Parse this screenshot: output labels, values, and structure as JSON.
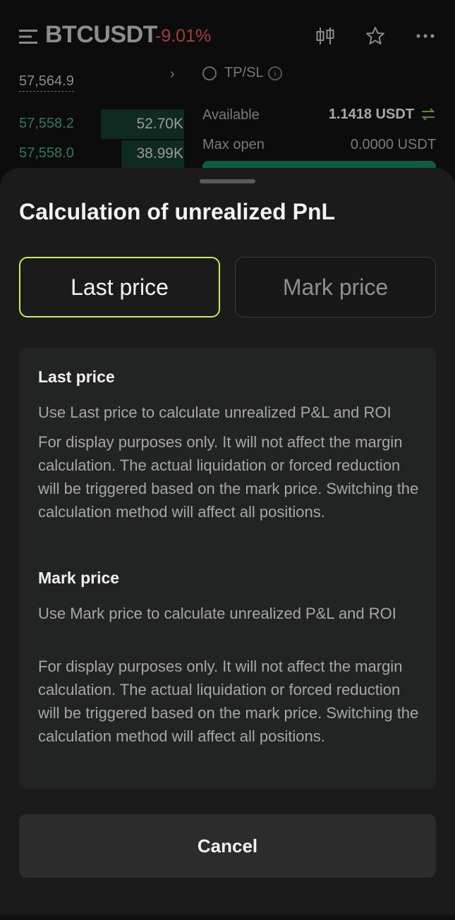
{
  "header": {
    "symbol": "BTCUSDT",
    "change": "-9.01%",
    "icons": [
      "menu-icon",
      "candlestick-icon",
      "star-icon",
      "more-icon"
    ]
  },
  "orderbook": {
    "reference_price": "57,564.9",
    "rows": [
      {
        "price": "57,558.2",
        "size": "52.70K"
      },
      {
        "price": "57,558.0",
        "size": "38.99K"
      }
    ]
  },
  "order_panel": {
    "tpsl_label": "TP/SL",
    "available_label": "Available",
    "available_value": "1.1418 USDT",
    "max_open_label": "Max open",
    "max_open_value": "0.0000  USDT"
  },
  "sheet": {
    "title": "Calculation of unrealized PnL",
    "options": [
      {
        "label": "Last price",
        "selected": true
      },
      {
        "label": "Mark price",
        "selected": false
      }
    ],
    "sections": [
      {
        "title": "Last price",
        "subtitle": "Use Last price to calculate unrealized P&L and ROI",
        "body": "For display purposes only. It will not affect the margin calculation. The actual liquidation or forced reduction will be triggered based on the mark price. Switching the calculation method will affect all positions."
      },
      {
        "title": "Mark price",
        "subtitle": "Use Mark price to calculate unrealized P&L and ROI",
        "body": "For display purposes only. It will not affect the margin calculation. The actual liquidation or forced reduction will be triggered based on the mark price. Switching the calculation method will affect all positions."
      }
    ],
    "cancel_label": "Cancel"
  },
  "colors": {
    "accent_border": "#c6ef5c",
    "negative": "#a83c3c",
    "positive": "#2e7a5b",
    "sheet_bg": "#1b1b1b"
  }
}
